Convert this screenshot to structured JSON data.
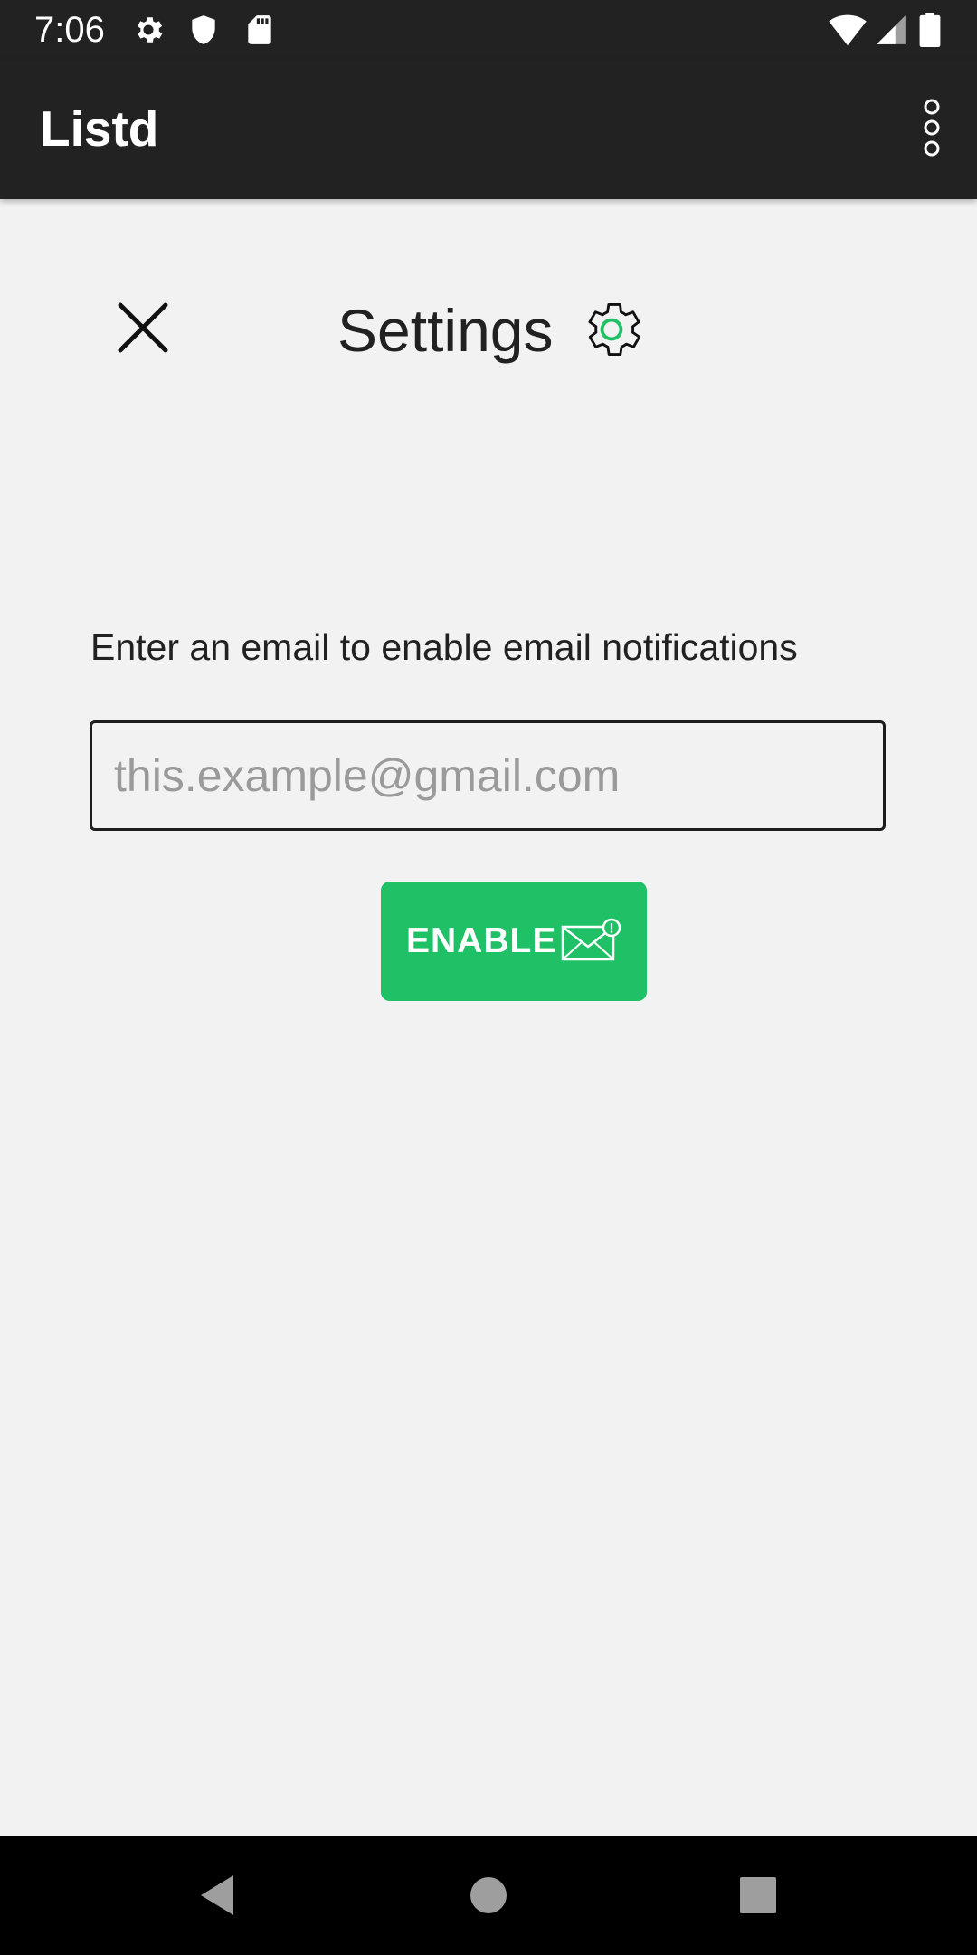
{
  "status_bar": {
    "time": "7:06",
    "left_icons": [
      "settings-icon",
      "shield-icon",
      "sd-card-icon"
    ],
    "right_icons": [
      "wifi-icon",
      "signal-icon",
      "battery-icon"
    ]
  },
  "app_bar": {
    "title": "Listd",
    "overflow_icon": "more-vert-icon"
  },
  "settings": {
    "title": "Settings",
    "close_icon": "close-icon",
    "title_icon": "gear-icon",
    "prompt": "Enter an email to enable email notifications",
    "email_placeholder": "this.example@gmail.com",
    "email_value": "",
    "enable_label": "ENABLE",
    "enable_icon": "mail-alert-icon"
  },
  "colors": {
    "bar_background": "#222222",
    "page_background": "#f2f2f2",
    "accent_green": "#20c067",
    "text_dark": "#212121",
    "placeholder_grey": "#9a9a9a"
  },
  "nav_bar": {
    "buttons": [
      "back-icon",
      "home-icon",
      "recents-icon"
    ]
  }
}
